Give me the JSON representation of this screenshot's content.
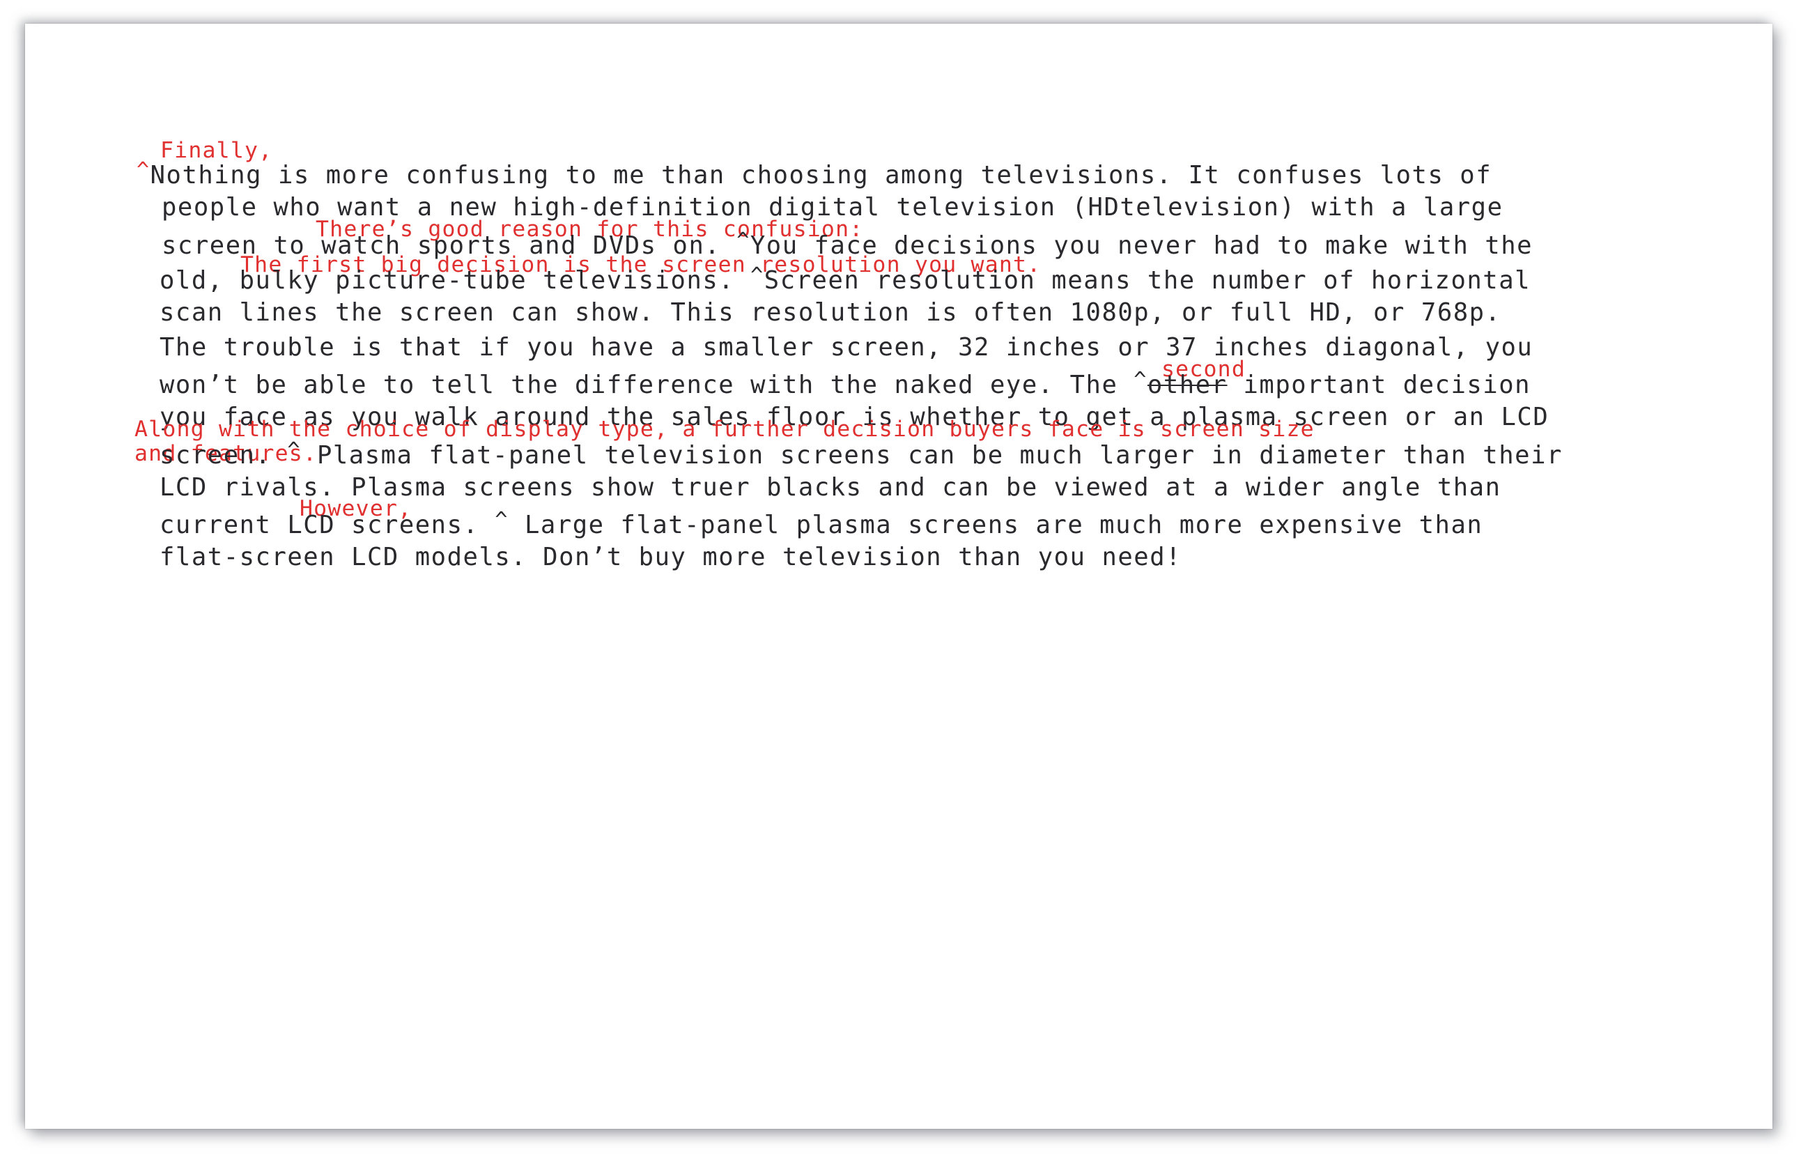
{
  "document": {
    "kind": "marked-up-draft-page",
    "paper_color": "#ffffff",
    "body_text_color": "#2a2a2e",
    "annotation_color": "#e03030",
    "body_lines": [
      "  ^Nothing is more confusing to me than choosing among televisions. It confuses lots of",
      "people who want a new high-definition digital television (HDtelevision) with a large",
      "screen to watch sports and DVDs on. ^You face decisions you never had to make with the",
      "old, bulky picture-tube televisions. ^Screen resolution means the number of horizontal",
      "scan lines the screen can show. This resolution is often 1080p, or full HD, or 768p.",
      "The trouble is that if you have a smaller screen, 32 inches or 37 inches diagonal, you",
      "won’t be able to tell the difference with the naked eye. The ^other important decision",
      "you face as you walk around the sales floor is whether to get a plasma screen or an LCD",
      "screen. ^ Plasma flat-panel television screens can be much larger in diameter than their",
      "LCD rivals. Plasma screens show truer blacks and can be viewed at a wider angle than",
      "current LCD screens. ^ Large flat-panel plasma screens are much more expensive than",
      "flat-screen LCD models. Don’t buy more television than you need!"
    ],
    "line1": {
      "caret": "^",
      "text": "Nothing is more confusing to me than choosing among televisions. It confuses lots of"
    },
    "line2": "people who want a new high-definition digital television (HDtelevision) with a large",
    "line3": {
      "before": "screen to watch sports and DVDs on. ",
      "caret": "^",
      "after": "You face decisions you never had to make with the"
    },
    "line4": {
      "before": "old, bulky picture-tube televisions. ",
      "caret": "^",
      "after": "Screen resolution means the number of horizontal"
    },
    "line5": "scan lines the screen can show. This resolution is often 1080p, or full HD, or 768p.",
    "line6": "The trouble is that if you have a smaller screen, 32 inches or 37 inches diagonal, you",
    "line7": {
      "before": "won’t be able to tell the difference with the naked eye. The ",
      "caret": "^",
      "struck": "other",
      "after": " important decision"
    },
    "line8": "you face as you walk around the sales floor is whether to get a plasma screen or an LCD",
    "line9": {
      "before": "screen. ",
      "caret": "^",
      "after": " Plasma flat-panel television screens can be much larger in diameter than their"
    },
    "line10": "LCD rivals. Plasma screens show truer blacks and can be viewed at a wider angle than",
    "line11": {
      "before": "current LCD screens. ",
      "caret": "^",
      "after": " Large flat-panel plasma screens are much more expensive than"
    },
    "line12": "flat-screen LCD models. Don’t buy more television than you need!",
    "annotations": [
      {
        "id": "ins-finally",
        "text": "Finally,"
      },
      {
        "id": "ins-reason",
        "text": "There’s good reason for this confusion:"
      },
      {
        "id": "ins-first",
        "text": "The first big decision is the screen resolution you want."
      },
      {
        "id": "ins-second",
        "text": "second"
      },
      {
        "id": "ins-along-l1",
        "text": "Along with the choice of display type, a further decision buyers face is screen size"
      },
      {
        "id": "ins-along-l2",
        "text": "and features."
      },
      {
        "id": "ins-however",
        "text": "However,"
      }
    ],
    "strikethrough_word": "other"
  }
}
